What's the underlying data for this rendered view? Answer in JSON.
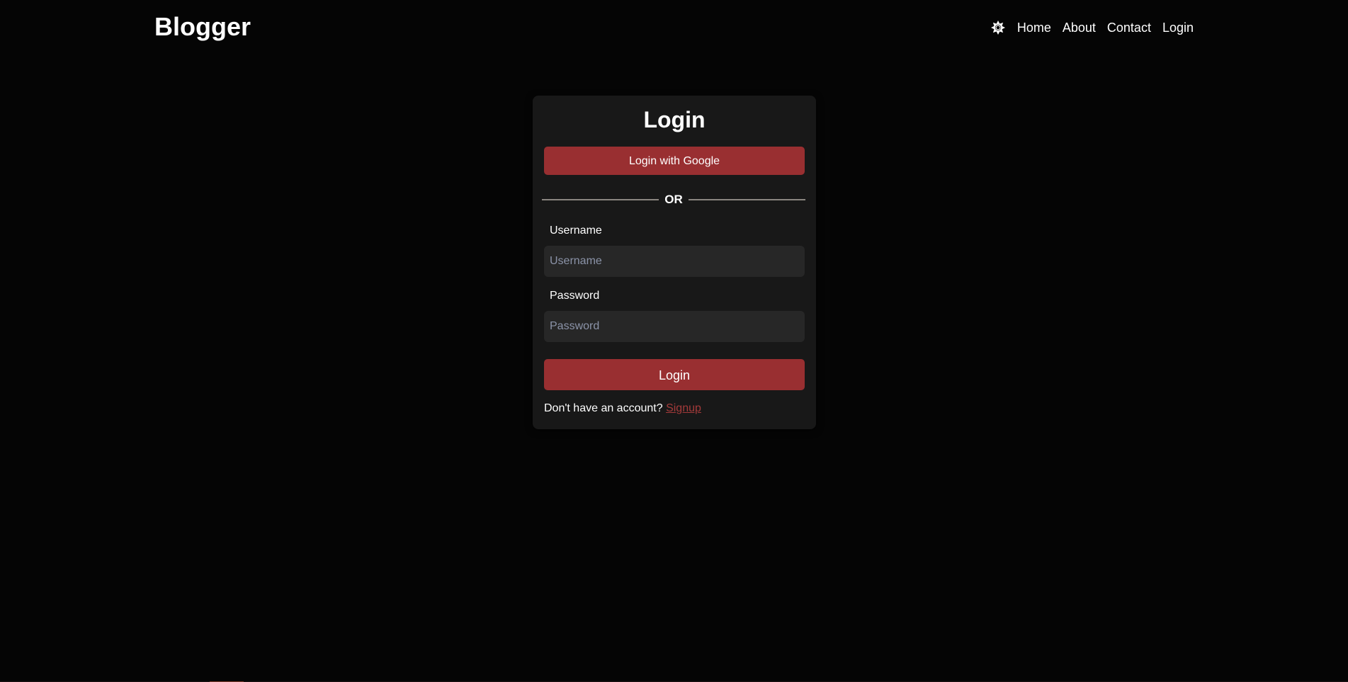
{
  "navbar": {
    "brand": "Blogger",
    "theme_toggle_icon": "sun-icon",
    "links": [
      {
        "label": "Home"
      },
      {
        "label": "About"
      },
      {
        "label": "Contact"
      },
      {
        "label": "Login"
      }
    ]
  },
  "login_card": {
    "title": "Login",
    "google_button": "Login with Google",
    "divider_text": "OR",
    "username": {
      "label": "Username",
      "placeholder": "Username",
      "value": ""
    },
    "password": {
      "label": "Password",
      "placeholder": "Password",
      "value": ""
    },
    "submit_button": "Login",
    "signup_prompt": "Don't have an account?",
    "signup_link": "Signup"
  },
  "colors": {
    "background": "#050505",
    "card": "#181818",
    "accent": "#992f31",
    "input": "#272727",
    "link": "#a43a3a"
  }
}
